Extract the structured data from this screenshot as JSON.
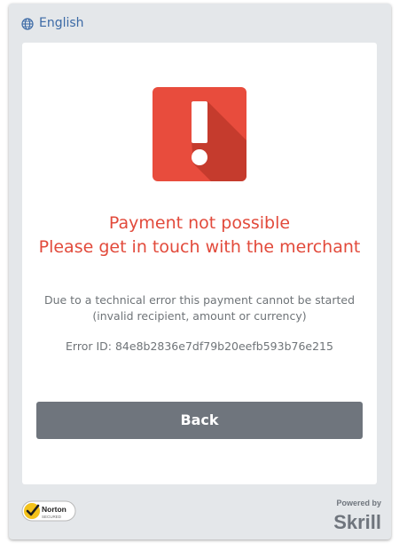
{
  "language": {
    "label": "English",
    "icon": "globe-icon"
  },
  "error": {
    "icon": "exclamation-icon",
    "title": "Payment not possible",
    "subtitle": "Please get in touch with the merchant",
    "description_line1": "Due to a technical error this payment cannot be started",
    "description_line2": "(invalid recipient, amount or currency)",
    "error_id": "Error ID: 84e8b2836e7df79b20eefb593b76e215"
  },
  "actions": {
    "back_label": "Back"
  },
  "footer": {
    "norton_logo_text": "Norton",
    "norton_secured_text": "SECURED",
    "powered_by": "Powered by",
    "brand": "Skrill"
  },
  "colors": {
    "accent_red": "#e24a3b",
    "button_gray": "#6f757d",
    "link_blue": "#3c6aa6",
    "frame_bg": "#e4e7ea"
  }
}
